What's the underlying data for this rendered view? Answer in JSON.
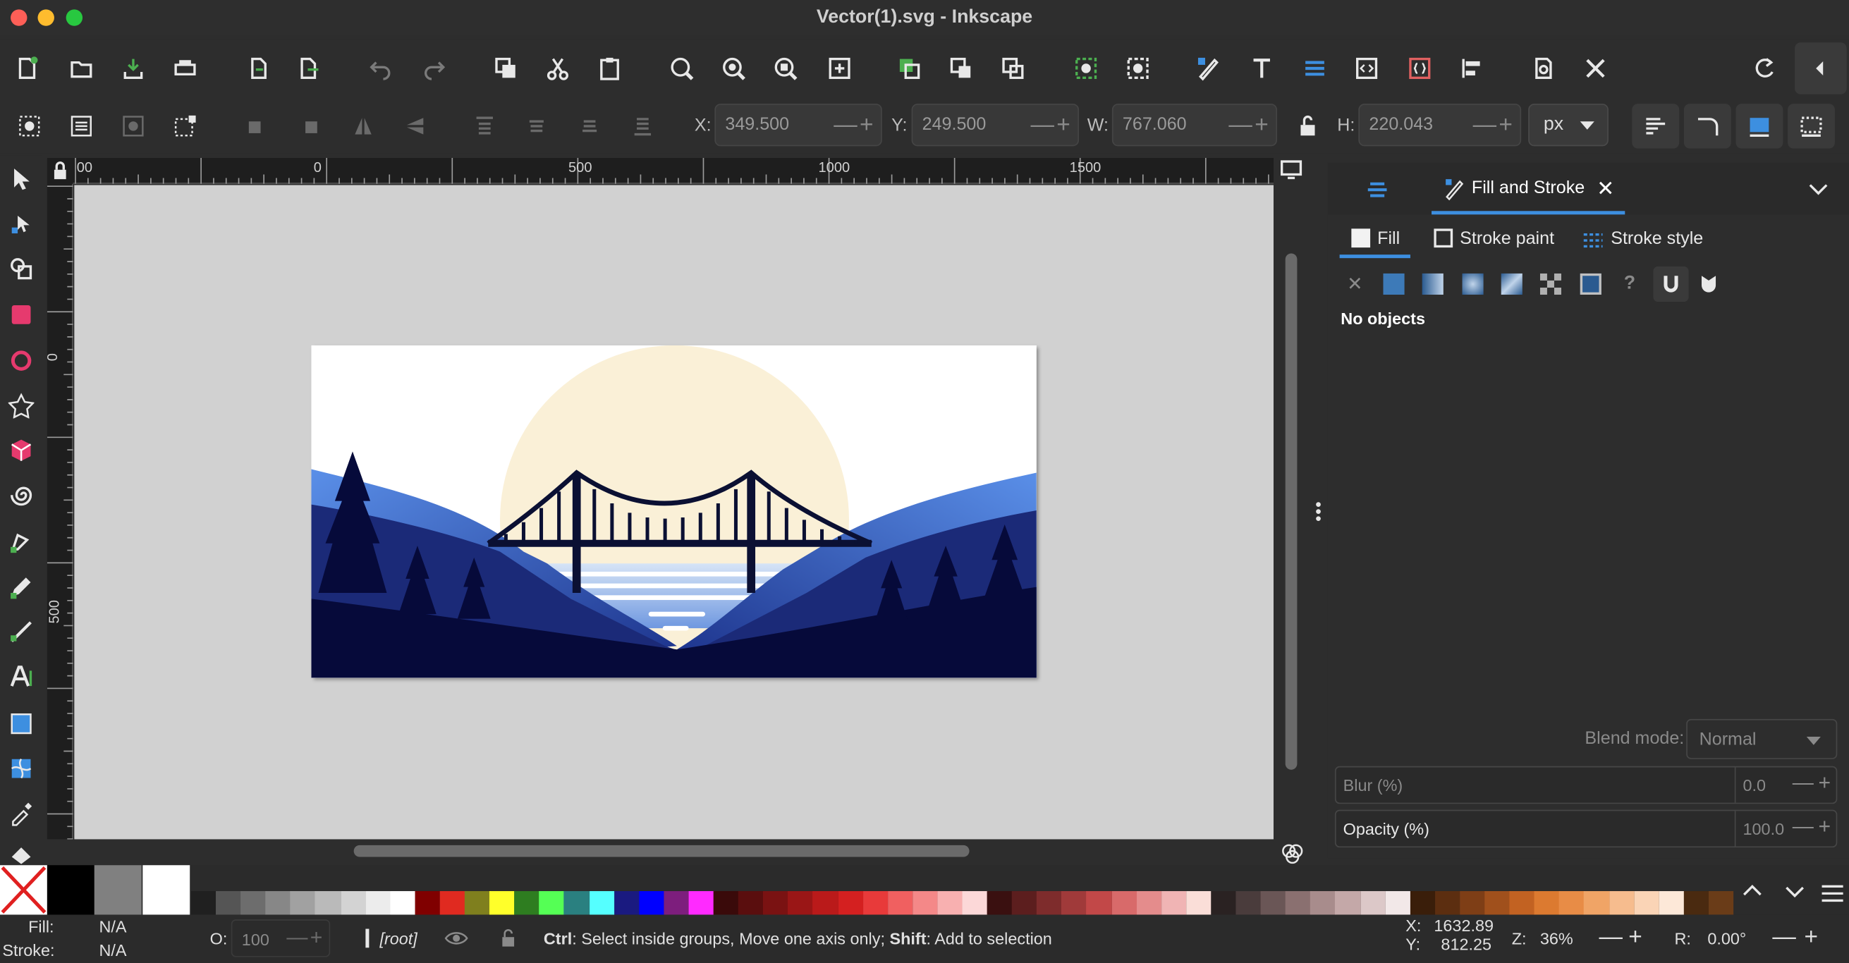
{
  "window": {
    "title": "Vector(1).svg - Inkscape"
  },
  "toolbar": {
    "x_label": "X:",
    "x_value": "349.500",
    "y_label": "Y:",
    "y_value": "249.500",
    "w_label": "W:",
    "w_value": "767.060",
    "h_label": "H:",
    "h_value": "220.043",
    "unit": "px",
    "spin_minus": "—",
    "spin_plus": "+"
  },
  "rulers": {
    "top": [
      "00",
      "0",
      "500",
      "1000",
      "1500"
    ],
    "left": [
      "0",
      "500"
    ]
  },
  "dock": {
    "tab_label": "Fill and Stroke",
    "fill_tab": "Fill",
    "stroke_paint_tab": "Stroke paint",
    "stroke_style_tab": "Stroke style",
    "no_objects": "No objects",
    "blend_label": "Blend mode:",
    "blend_value": "Normal",
    "blur_label": "Blur (%)",
    "blur_value": "0.0",
    "opacity_label": "Opacity (%)",
    "opacity_value": "100.0",
    "unset_symbol": "✕",
    "unknown_symbol": "?"
  },
  "status": {
    "fill_label": "Fill:",
    "fill_value": "N/A",
    "stroke_label": "Stroke:",
    "stroke_value": "N/A",
    "o_label": "O:",
    "o_value": "100",
    "layer": "[root]",
    "message_ctrl": "Ctrl",
    "message_1": ": Select inside groups, Move one axis only; ",
    "message_shift": "Shift",
    "message_2": ": Add to selection",
    "cursor_x_label": "X:",
    "cursor_x": "1632.89",
    "cursor_y_label": "Y:",
    "cursor_y": "812.25",
    "zoom_label": "Z:",
    "zoom": "36%",
    "rotate_label": "R:",
    "rotate": "0.00°"
  },
  "palette": {
    "colors": [
      "#202020",
      "#555555",
      "#6d6d6d",
      "#878787",
      "#a1a1a1",
      "#bababa",
      "#d3d3d3",
      "#ececec",
      "#ffffff",
      "#800000",
      "#e02a20",
      "#7f7f1e",
      "#ffff2a",
      "#2e7d20",
      "#55ff55",
      "#2a8080",
      "#55ffff",
      "#1a1a80",
      "#0000ff",
      "#7d1e7d",
      "#ff2aff",
      "#3a0a0a",
      "#5a0e0e",
      "#7a1212",
      "#9a1616",
      "#ba1a1a",
      "#d42020",
      "#e83a3a",
      "#f06060",
      "#f48888",
      "#f8b0b0",
      "#fcd8d8",
      "#3a1010",
      "#5c1e1e",
      "#7e2c2c",
      "#a03a3a",
      "#c24848",
      "#d86a6a",
      "#e48c8c",
      "#f0b4b4",
      "#faded8",
      "#2a2222",
      "#4a3c3c",
      "#6a5656",
      "#8a7070",
      "#a88c8c",
      "#c4a8a8",
      "#dcc8c8",
      "#f2e8e8",
      "#3a1e0a",
      "#5c2e10",
      "#7e3e16",
      "#a0501c",
      "#c26222",
      "#dc7a30",
      "#e88c46",
      "#f0a466",
      "#f6bc8e",
      "#fad4b6",
      "#fde8d8",
      "#4a2a10",
      "#6a3c18"
    ],
    "big": [
      "none",
      "#000000",
      "#808080",
      "#ffffff"
    ]
  },
  "icons": {
    "new": "new-document-icon",
    "open": "open-folder-icon",
    "save": "save-icon",
    "print": "print-icon",
    "import": "import-icon",
    "export": "export-icon",
    "undo": "undo-icon",
    "redo": "redo-icon",
    "copy": "copy-icon",
    "cut": "cut-icon",
    "paste": "paste-icon",
    "zoom_sel": "zoom-selection-icon",
    "zoom_draw": "zoom-drawing-icon",
    "zoom_page": "zoom-page-icon",
    "zoom_center": "zoom-center-icon",
    "dup": "duplicate-icon",
    "clone": "clone-icon",
    "unlink": "unlink-clone-icon",
    "group": "group-icon",
    "ungroup": "ungroup-icon",
    "fillstroke": "fill-stroke-icon",
    "text": "text-icon",
    "layers": "layers-icon",
    "xml": "xml-editor-icon",
    "selectors": "selectors-icon",
    "align": "align-icon",
    "docprops": "document-properties-icon",
    "prefs": "preferences-icon"
  }
}
